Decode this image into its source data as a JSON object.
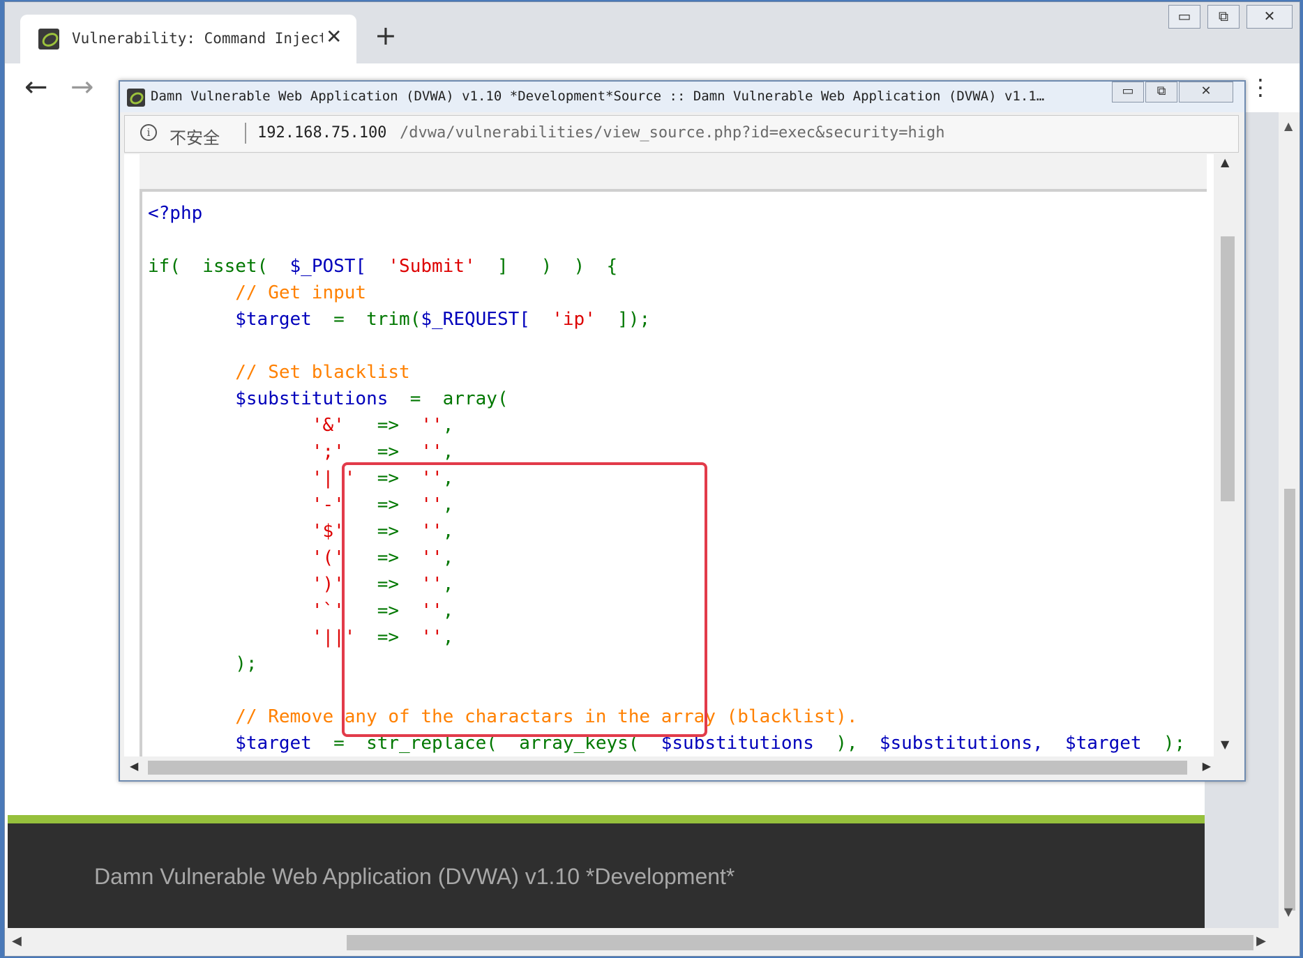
{
  "browser": {
    "tab_title": "Vulnerability: Command Inject",
    "tab_close": "✕",
    "new_tab": "+",
    "back": "←",
    "forward": "→",
    "menu": "⋮",
    "win_min": "▭",
    "win_max": "⧉",
    "win_close": "✕"
  },
  "popup": {
    "title": "Damn Vulnerable Web Application (DVWA) v1.10 *Development*Source :: Damn Vulnerable Web Application (DVWA) v1.1…",
    "insecure_label": "不安全",
    "url_host": "192.168.75.100",
    "url_path": "/dvwa/vulnerabilities/view_source.php?id=exec&security=high",
    "win_min": "▭",
    "win_max": "⧉",
    "win_close": "✕"
  },
  "code": {
    "open_tag": "<?php",
    "if_kw": "if(",
    "isset_kw": "isset(",
    "post_var": "$_POST[",
    "submit_str": "'Submit'",
    "if_close": "]   )  )  {",
    "comment_get": "// Get input",
    "target_var": "$target",
    "eq": "=",
    "trim_kw": "trim(",
    "request_var": "$_REQUEST[",
    "ip_str": "'ip'",
    "trim_close": "]);",
    "comment_set": "// Set blacklist",
    "subs_var": "$substitutions",
    "array_kw": "array(",
    "arrow": "=>",
    "empty_str": "''",
    "comma": ",",
    "keys": [
      "'&'",
      "';'",
      "'| '",
      "'-'",
      "'$'",
      "'('",
      "')'",
      "'`'",
      "'||'"
    ],
    "array_close": ");",
    "comment_remove": "// Remove any of the charactars in the array (blacklist).",
    "str_replace_kw": "str_replace(",
    "array_keys_kw": "array_keys(",
    "subs_close": "),",
    "subs_var2": "$substitutions,",
    "target_var2": "$target",
    "replace_close": ");"
  },
  "footer": {
    "text": "Damn Vulnerable Web Application (DVWA) v1.10 *Development*"
  },
  "colors": {
    "highlight_border": "#e23b4a",
    "php_keyword": "#007700",
    "php_string": "#dd0000",
    "php_comment": "#ff8000",
    "php_default": "#0000bb",
    "footer_band": "#96c03c"
  }
}
